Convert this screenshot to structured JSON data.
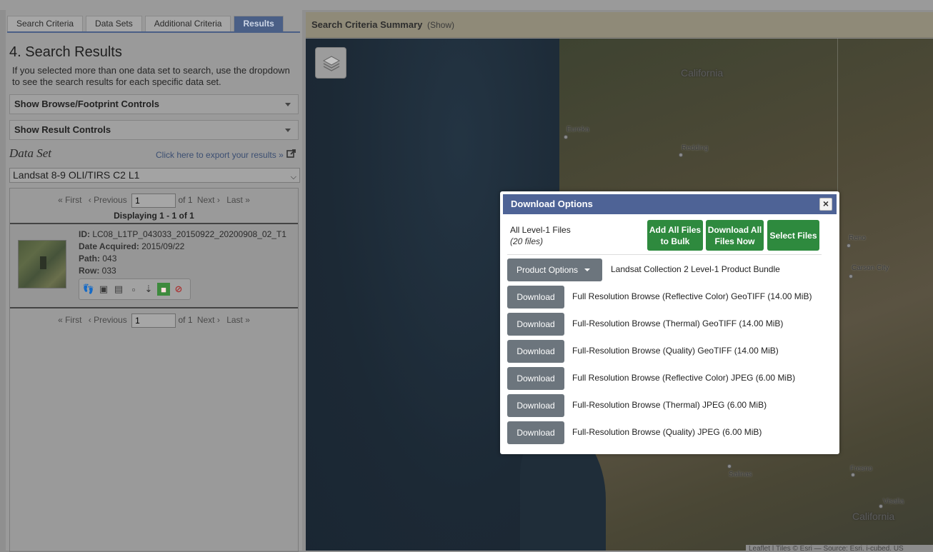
{
  "tabs": [
    "Search Criteria",
    "Data Sets",
    "Additional Criteria",
    "Results"
  ],
  "results": {
    "title": "4. Search Results",
    "help": "If you selected more than one data set to search, use the dropdown to see the search results for each specific data set.",
    "accordion_browse": "Show Browse/Footprint Controls",
    "accordion_result": "Show Result Controls",
    "dataset_label": "Data Set",
    "export_link": "Click here to export your results »",
    "dataset_selected": "Landsat 8-9 OLI/TIRS C2 L1",
    "pager": {
      "first": "« First",
      "previous": "‹ Previous",
      "page_value": "1",
      "of_text": "of 1",
      "next": "Next ›",
      "last": "Last »"
    },
    "displaying": "Displaying 1 - 1 of 1",
    "item": {
      "id_label": "ID:",
      "id_value": "LC08_L1TP_043033_20150922_20200908_02_T1",
      "date_label": "Date Acquired:",
      "date_value": "2015/09/22",
      "path_label": "Path:",
      "path_value": "043",
      "row_label": "Row:",
      "row_value": "033",
      "tools": [
        "footprint-icon",
        "browse-icon",
        "metadata-icon",
        "compare-icon",
        "download-icon",
        "order-icon",
        "exclude-icon"
      ]
    }
  },
  "map": {
    "header_title": "Search Criteria Summary",
    "header_show": "(Show)",
    "labels": {
      "california_top": "California",
      "eureka": "Eureka",
      "redding": "Redding",
      "reno": "Reno",
      "carson_city": "Carson City",
      "salinas": "Salinas",
      "fresno": "Fresno",
      "visalia": "Visalia",
      "california_bottom": "California"
    },
    "attribution": "Leaflet | Tiles © Esri — Source: Esri, i-cubed, US"
  },
  "modal": {
    "title": "Download Options",
    "close": "×",
    "all_files_label": "All Level-1 Files",
    "all_files_count": "(20 files)",
    "add_bulk_line1": "Add All Files",
    "add_bulk_line2": "to Bulk",
    "download_all_line1": "Download All",
    "download_all_line2": "Files Now",
    "select_files": "Select Files",
    "product_options": "Product Options",
    "bundle": "Landsat Collection 2 Level-1 Product Bundle",
    "download_label": "Download",
    "items": [
      "Full Resolution Browse (Reflective Color) GeoTIFF (14.00 MiB)",
      "Full-Resolution Browse (Thermal) GeoTIFF (14.00 MiB)",
      "Full-Resolution Browse (Quality) GeoTIFF (14.00 MiB)",
      "Full Resolution Browse (Reflective Color) JPEG (6.00 MiB)",
      "Full-Resolution Browse (Thermal) JPEG (6.00 MiB)",
      "Full-Resolution Browse (Quality) JPEG (6.00 MiB)"
    ]
  },
  "colors": {
    "tab_active": "#4a5f86",
    "modal_header": "#4e6396",
    "green_button": "#2e8a3e",
    "gray_button": "#6c757d"
  }
}
